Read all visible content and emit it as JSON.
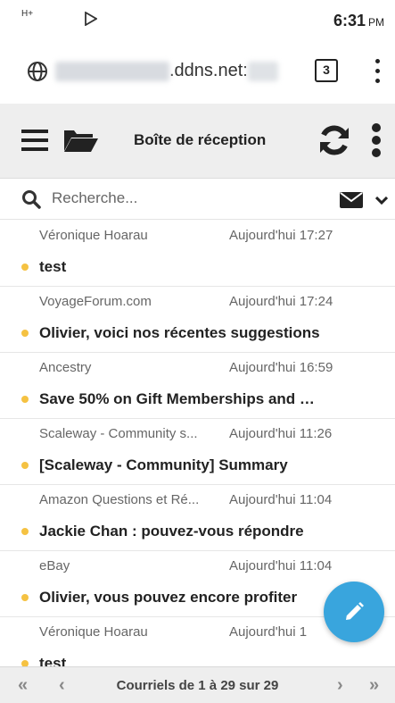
{
  "status": {
    "network": "H+",
    "time": "6:31",
    "ampm": "PM"
  },
  "browser": {
    "url_visible": ".ddns.net:",
    "tab_count": "3"
  },
  "header": {
    "title": "Boîte de réception"
  },
  "search": {
    "placeholder": "Recherche..."
  },
  "messages": [
    {
      "from": "Véronique Hoarau",
      "date": "Aujourd'hui 17:27",
      "subject": "test"
    },
    {
      "from": "VoyageForum.com",
      "date": "Aujourd'hui 17:24",
      "subject": "Olivier, voici nos récentes suggestions"
    },
    {
      "from": "Ancestry",
      "date": "Aujourd'hui 16:59",
      "subject": "Save 50% on Gift Memberships and more"
    },
    {
      "from": "Scaleway - Community s...",
      "date": "Aujourd'hui 11:26",
      "subject": "[Scaleway - Community] Summary"
    },
    {
      "from": "Amazon Questions et Ré...",
      "date": "Aujourd'hui 11:04",
      "subject": "Jackie Chan : pouvez-vous répondre"
    },
    {
      "from": "eBay",
      "date": "Aujourd'hui 11:04",
      "subject": "Olivier, vous pouvez encore profiter"
    },
    {
      "from": "Véronique Hoarau",
      "date": "Aujourd'hui 1",
      "subject": "test"
    }
  ],
  "pager": {
    "label": "Courriels de 1 à 29 sur 29",
    "first": "«",
    "prev": "‹",
    "next": "›",
    "last": "»"
  },
  "colors": {
    "unread_dot": "#f5c242",
    "fab": "#39a5dd"
  }
}
